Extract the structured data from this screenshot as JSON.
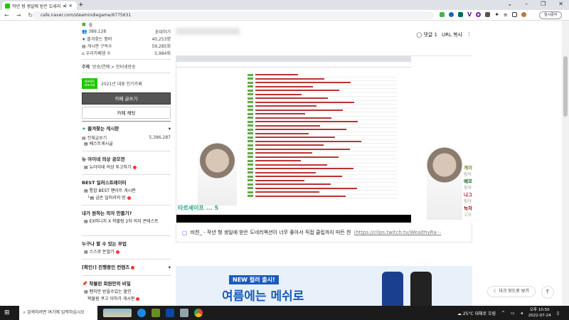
{
  "browser": {
    "tab_title": "작년 형 생일에 받은 도네리",
    "url": "cafe.naver.com/steamindiegame/6775631",
    "pause_label": "일시중지"
  },
  "sidebar": {
    "level": "숲",
    "members": "389,128",
    "invite": "초대하기",
    "stats": [
      {
        "label": "즐겨찾는 멤버",
        "value": "40,253명"
      },
      {
        "label": "게시판 구독수",
        "value": "59,285회"
      },
      {
        "label": "우리카페앱 수",
        "value": "5,984회"
      }
    ],
    "topic_label": "주제",
    "topic": "방송/연예 > 인터넷방송",
    "naver_badge": "NAVER 대표카페",
    "award": "2021년 대표 인기카페",
    "write_btn": "카페 글쓰기",
    "chat_btn": "카페 채팅",
    "fav_header": "즐겨찾는 게시판",
    "all_posts": "전체글보기",
    "all_count": "5,386,287",
    "best_posts": "베스트게시글",
    "sections": [
      {
        "title": "뉴 아이네 의상 공모전",
        "items": [
          "뉴아이네 의상 투고하기"
        ]
      },
      {
        "title": "BEST 일러스트레이터",
        "items": [
          "통합 BEST 팬아트 게시판",
          "금손 일러리의 방"
        ]
      },
      {
        "title": "내가 원하는 의자 만들기?",
        "items": [
          "EX피니치 X 착불링 2차 의자 콘테스트"
        ]
      },
      {
        "title": "누구나 할 수 있는 부업",
        "items": [
          "스스로 돈벌기"
        ]
      },
      {
        "title": "[확인!] 진행중인 컨텐츠",
        "items": []
      },
      {
        "title": "착불왼 회원만의 비밀",
        "items": [
          "팬치만 받을수있는 할인",
          "왁물원 쿠고 이하가 게시판"
        ]
      }
    ]
  },
  "article": {
    "comments": "댓글 1",
    "url_copy": "URL 복사",
    "video_title": "타르세이프 ... 5",
    "overlay": [
      {
        "name": "게이머는역사",
        "sub": "링아"
      },
      {
        "name": "메모짱",
        "sub": "링아"
      },
      {
        "name": "나그게임한다",
        "sub": "링아"
      },
      {
        "name": "녹차반덧불",
        "sub": "고오급 인력들"
      }
    ],
    "caption": "비챤_ - 작년 형 생일에 받은 도네리액션이 너무 좋아서 직접 클립까지 따든 챤",
    "link": "(https://clips.twitch.tv/WealthyRa···",
    "ad_badge": "NEW 컬러 출시!",
    "ad_text": "여름에는 메쉬로"
  },
  "floating": {
    "dark_mode": "다크 모드로 보기",
    "top": "⤒"
  },
  "taskbar": {
    "search": "검색하려면 여기에 입력하십시오",
    "weather": "25°C 대체로 흐림",
    "time": "오후 10:50",
    "date": "2022-07-24"
  }
}
